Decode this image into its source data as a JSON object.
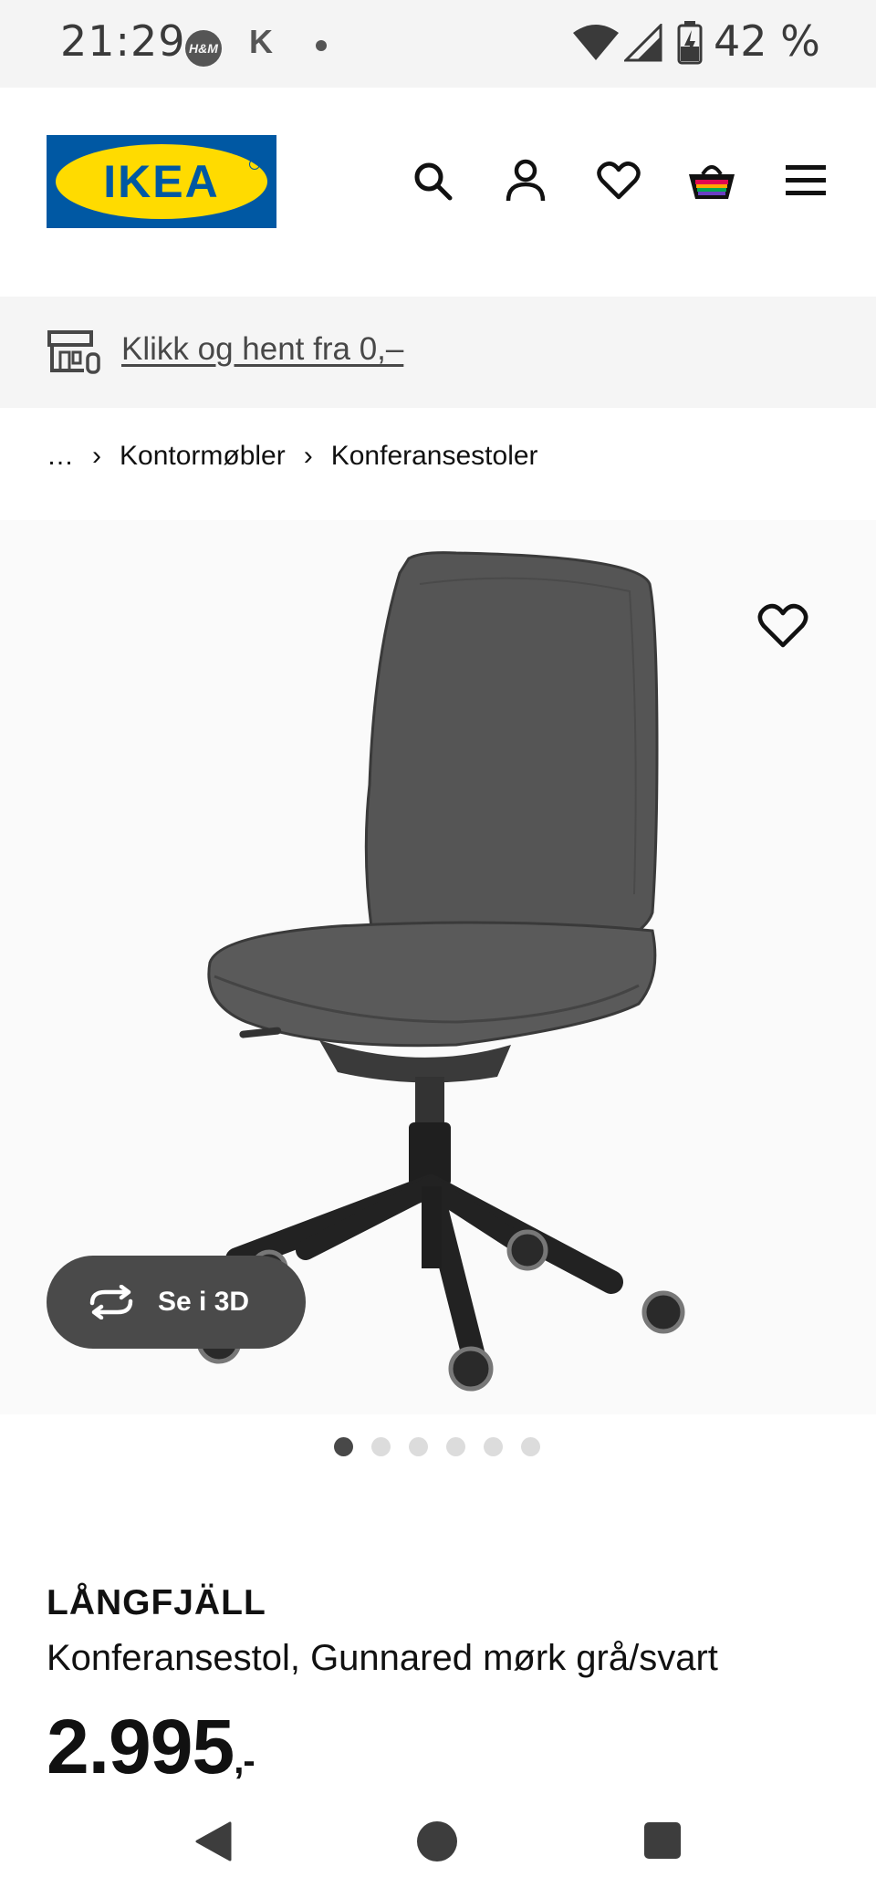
{
  "status_bar": {
    "time": "21:29",
    "hm_badge": "H&M",
    "k_badge": "K",
    "battery": "42 %"
  },
  "header": {
    "logo_text": "IKEA",
    "icons": [
      "search-icon",
      "account-icon",
      "heart-icon",
      "cart-icon",
      "menu-icon"
    ]
  },
  "banner": {
    "text": "Klikk og hent fra 0,–"
  },
  "breadcrumb": {
    "items": [
      "…",
      "Kontormøbler",
      "Konferansestoler"
    ]
  },
  "gallery": {
    "button_3d": "Se i 3D",
    "page_count": 6,
    "active_page": 1
  },
  "product": {
    "name": "LÅNGFJÄLL",
    "description": "Konferansestol, Gunnared mørk grå/svart",
    "price_main": "2.995",
    "price_suffix": ",-"
  },
  "colors": {
    "brand_blue": "#0058a3",
    "brand_yellow": "#ffdb00"
  }
}
